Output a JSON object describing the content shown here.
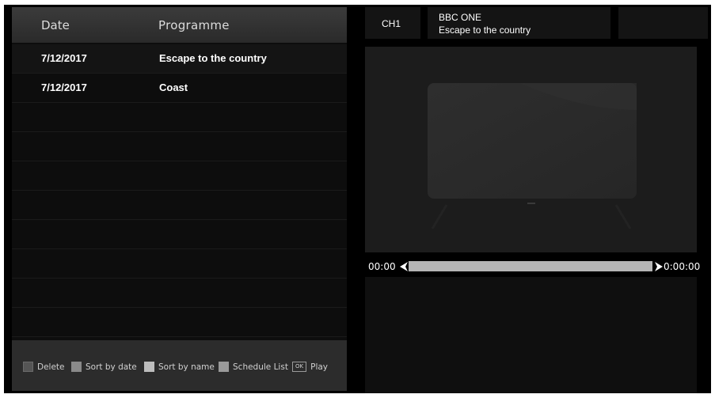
{
  "list": {
    "header": {
      "date": "Date",
      "programme": "Programme"
    },
    "rows": [
      {
        "date": "7/12/2017",
        "programme": "Escape to the country"
      },
      {
        "date": "7/12/2017",
        "programme": "Coast"
      }
    ]
  },
  "footer": {
    "delete_label": "Delete",
    "sort_date_label": "Sort by date",
    "sort_name_label": "Sort by name",
    "schedule_label": "Schedule List",
    "ok_key": "OK",
    "play_label": "Play"
  },
  "info": {
    "channel_number": "CH1",
    "channel_name": "BBC ONE",
    "programme_title": "Escape to the country"
  },
  "playback": {
    "start_time": "00:00",
    "end_time": "0:00:00",
    "progress_fraction": 1.0
  },
  "colors": {
    "background": "#000000",
    "panel": "#0d0d0d",
    "header": "#3b3b3b",
    "footer": "#2c2c2c",
    "progress": "#b5b5b5"
  },
  "icons": {
    "left_arrow": "triangle-left-icon",
    "right_arrow": "triangle-right-icon"
  }
}
